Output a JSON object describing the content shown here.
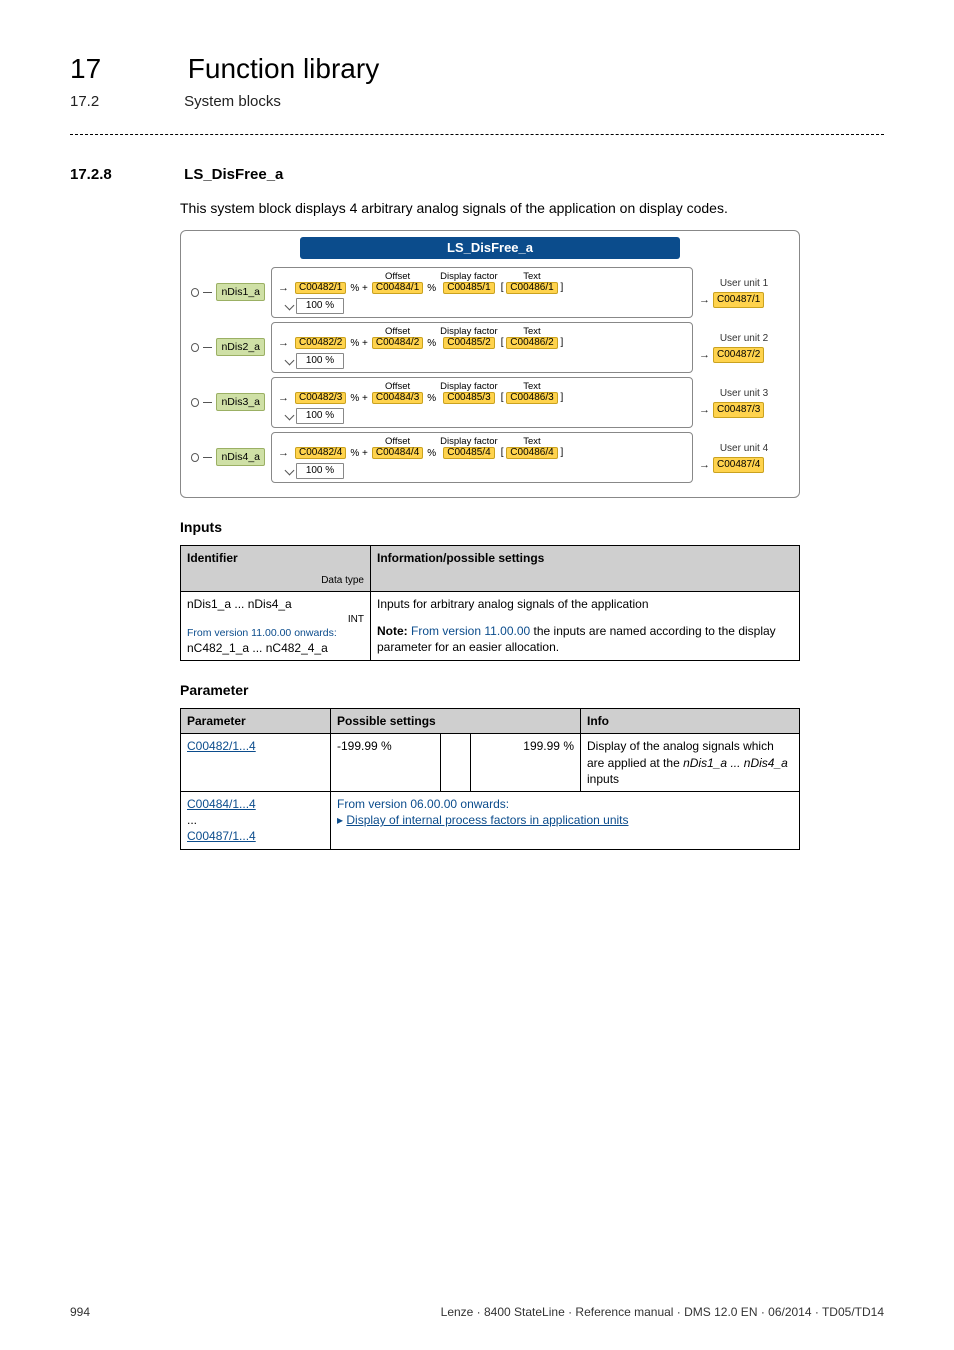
{
  "header": {
    "chapter_num": "17",
    "chapter_title": "Function library",
    "section_num": "17.2",
    "section_title": "System blocks"
  },
  "section": {
    "number": "17.2.8",
    "name": "LS_DisFree_a",
    "intro": "This system block displays 4 arbitrary analog signals of the application on display codes."
  },
  "diagram": {
    "title": "LS_DisFree_a",
    "offset_label": "Offset",
    "display_factor_label": "Display factor",
    "text_label": "Text",
    "hundred": "100 %",
    "pct_plus": "% +",
    "pct": "%",
    "bracket_open": "[",
    "bracket_close": "]",
    "rows": [
      {
        "input": "nDis1_a",
        "c482": "C00482/1",
        "c484": "C00484/1",
        "c485": "C00485/1",
        "c486": "C00486/1",
        "uu_label": "User unit 1",
        "c487": "C00487/1"
      },
      {
        "input": "nDis2_a",
        "c482": "C00482/2",
        "c484": "C00484/2",
        "c485": "C00485/2",
        "c486": "C00486/2",
        "uu_label": "User unit 2",
        "c487": "C00487/2"
      },
      {
        "input": "nDis3_a",
        "c482": "C00482/3",
        "c484": "C00484/3",
        "c485": "C00485/3",
        "c486": "C00486/3",
        "uu_label": "User unit 3",
        "c487": "C00487/3"
      },
      {
        "input": "nDis4_a",
        "c482": "C00482/4",
        "c484": "C00484/4",
        "c485": "C00485/4",
        "c486": "C00486/4",
        "uu_label": "User unit 4",
        "c487": "C00487/4"
      }
    ]
  },
  "inputs_heading": "Inputs",
  "inputs_table": {
    "col_identifier": "Identifier",
    "col_datatype": "Data type",
    "col_info": "Information/possible settings",
    "row1_ident": "nDis1_a ... nDis4_a",
    "row1_type": "INT",
    "row2_ident_prefix": "From version 11.00.00 onwards:",
    "row2_ident_main": "nC482_1_a ... nC482_4_a",
    "desc_line1": "Inputs for arbitrary analog signals of the application",
    "desc_note_label": "Note:",
    "desc_note_blue": "From version 11.00.00",
    "desc_note_rest": " the inputs are named according to the display parameter for an easier allocation."
  },
  "params_heading": "Parameter",
  "params_table": {
    "col_param": "Parameter",
    "col_possible": "Possible settings",
    "col_info": "Info",
    "row1_param": "C00482/1...4",
    "row1_min": "-199.99 %",
    "row1_max": "199.99 %",
    "row1_info_l1": "Display of the analog signals which are applied at the ",
    "row1_info_ital": "nDis1_a ... nDis4_a",
    "row1_info_l2": " inputs",
    "row2_param1": "C00484/1...4",
    "row2_ellipsis": "...",
    "row2_param2": "C00487/1...4",
    "row2_blue_plain": "From version 06.00.00 onwards:",
    "row2_link_marker": "▸ ",
    "row2_link": "Display of internal process factors in application units"
  },
  "footer": {
    "page": "994",
    "stamp": "Lenze · 8400 StateLine · Reference manual · DMS 12.0 EN · 06/2014 · TD05/TD14"
  }
}
